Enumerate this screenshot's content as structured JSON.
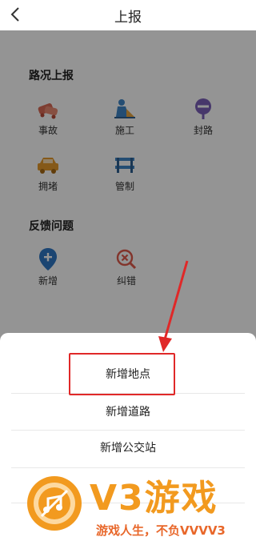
{
  "header": {
    "title": "上报"
  },
  "sections": [
    {
      "title": "路况上报"
    },
    {
      "title": "反馈问题"
    }
  ],
  "road_items": [
    {
      "label": "事故",
      "icon": "accident-icon"
    },
    {
      "label": "施工",
      "icon": "construction-icon"
    },
    {
      "label": "封路",
      "icon": "road-closed-icon"
    },
    {
      "label": "拥堵",
      "icon": "congestion-icon"
    },
    {
      "label": "管制",
      "icon": "traffic-control-icon"
    }
  ],
  "feedback_items": [
    {
      "label": "新增",
      "icon": "add-location-icon"
    },
    {
      "label": "纠错",
      "icon": "correction-icon"
    }
  ],
  "sheet": {
    "options": [
      "新增地点",
      "新增道路",
      "新增公交站"
    ]
  },
  "watermark": {
    "brand": "V3游戏",
    "slogan": "游戏人生，不负VVVV3"
  },
  "colors": {
    "accident": "#d96a55",
    "construction": "#3e86c6",
    "road_closed": "#7a5fb8",
    "congestion": "#e69a2c",
    "traffic_control": "#3e86c6",
    "add_location": "#2f78c4",
    "correction": "#e05a4a",
    "highlight": "#e02828",
    "watermark_orange": "#f29a1f"
  }
}
